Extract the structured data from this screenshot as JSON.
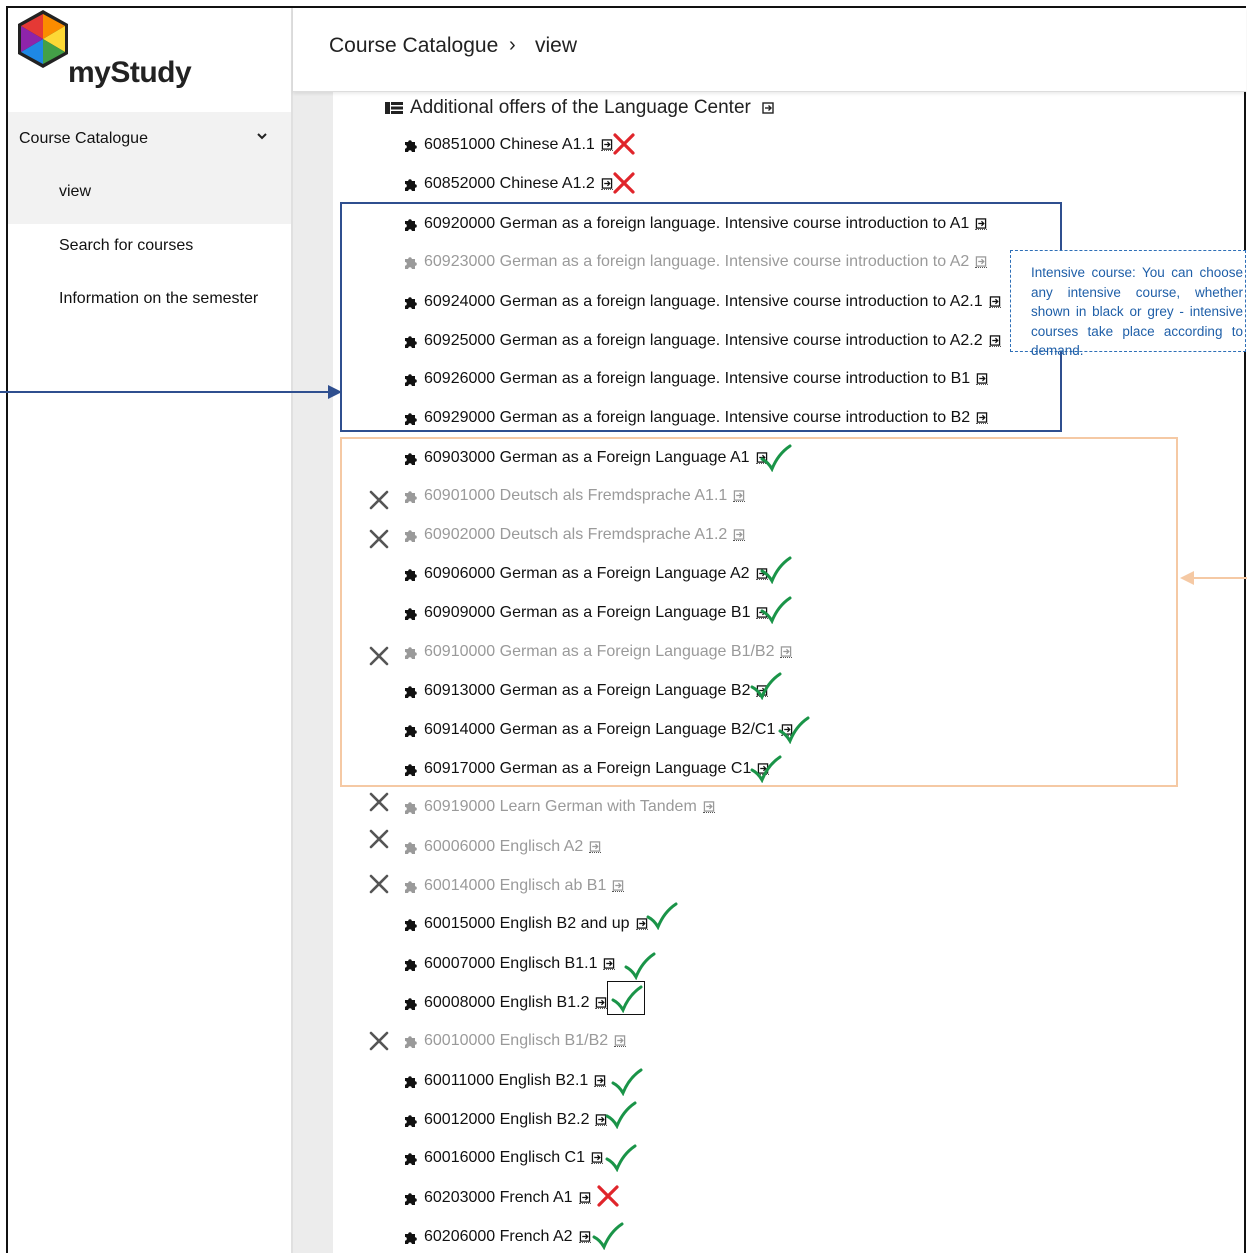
{
  "app": {
    "name": "myStudy"
  },
  "sidebar": {
    "group_label": "Course Catalogue",
    "items": [
      {
        "label": "view"
      },
      {
        "label": "Search for courses"
      },
      {
        "label": "Information on the semester"
      }
    ]
  },
  "header": {
    "breadcrumb": [
      "Course Catalogue",
      "view"
    ],
    "separator": "›"
  },
  "tree": {
    "section_title": "Additional offers of the Language Center",
    "courses": [
      {
        "label": "60851000 Chinese A1.1",
        "status": "grey-inactive-none",
        "mark": "red-x"
      },
      {
        "label": "60852000 Chinese A1.2",
        "mark": "red-x"
      },
      {
        "label": "60920000 German as a foreign language. Intensive course introduction to A1",
        "mark": "none"
      },
      {
        "label": "60923000 German as a foreign language. Intensive course introduction to A2",
        "grey": true,
        "mark": "none"
      },
      {
        "label": "60924000 German as a foreign language. Intensive course introduction to A2.1",
        "mark": "none"
      },
      {
        "label": "60925000 German as a foreign language. Intensive course introduction to A2.2",
        "mark": "none"
      },
      {
        "label": "60926000 German as a foreign language. Intensive course introduction to B1",
        "mark": "none"
      },
      {
        "label": "60929000 German as a foreign language. Intensive course introduction to B2",
        "mark": "none"
      },
      {
        "label": "60903000 German as a Foreign Language A1",
        "mark": "green-check"
      },
      {
        "label": "60901000 Deutsch als Fremdsprache A1.1",
        "grey": true,
        "mark": "grey-x"
      },
      {
        "label": "60902000 Deutsch als Fremdsprache A1.2",
        "grey": true,
        "mark": "grey-x"
      },
      {
        "label": "60906000 German as a Foreign Language A2",
        "mark": "green-check"
      },
      {
        "label": "60909000 German as a Foreign Language B1",
        "mark": "green-check"
      },
      {
        "label": "60910000 German as a Foreign Language B1/B2",
        "grey": true,
        "mark": "grey-x"
      },
      {
        "label": "60913000 German as a Foreign Language B2",
        "mark": "green-check"
      },
      {
        "label": "60914000 German as a Foreign Language B2/C1",
        "mark": "green-check"
      },
      {
        "label": "60917000 German as a Foreign Language C1",
        "mark": "green-check"
      },
      {
        "label": "60919000 Learn German with Tandem",
        "grey": true,
        "mark": "grey-x"
      },
      {
        "label": "60006000 Englisch A2",
        "grey": true,
        "mark": "grey-x"
      },
      {
        "label": "60014000 Englisch ab B1",
        "grey": true,
        "mark": "grey-x"
      },
      {
        "label": "60015000 English B2 and up",
        "mark": "green-check"
      },
      {
        "label": "60007000 Englisch B1.1",
        "mark": "green-check"
      },
      {
        "label": "60008000 English B1.2",
        "mark": "green-check-boxed"
      },
      {
        "label": "60010000 Englisch B1/B2",
        "grey": true,
        "mark": "grey-x"
      },
      {
        "label": "60011000 English B2.1",
        "mark": "green-check"
      },
      {
        "label": "60012000 English B2.2",
        "mark": "green-check"
      },
      {
        "label": "60016000 Englisch C1",
        "mark": "green-check"
      },
      {
        "label": "60203000 French A1",
        "mark": "red-x"
      },
      {
        "label": "60206000 French A2",
        "mark": "green-check"
      }
    ]
  },
  "annotation": {
    "note": "Intensive course: You can choose any intensive course, whether shown in black or grey - intensive courses take place according to demand."
  },
  "colors": {
    "check_green": "#1a9448",
    "cross_red": "#e0252b",
    "cross_grey": "#555555",
    "box_blue": "#2f4f8f",
    "box_orange": "#f5c9a4",
    "note_blue": "#1f5fa8"
  }
}
